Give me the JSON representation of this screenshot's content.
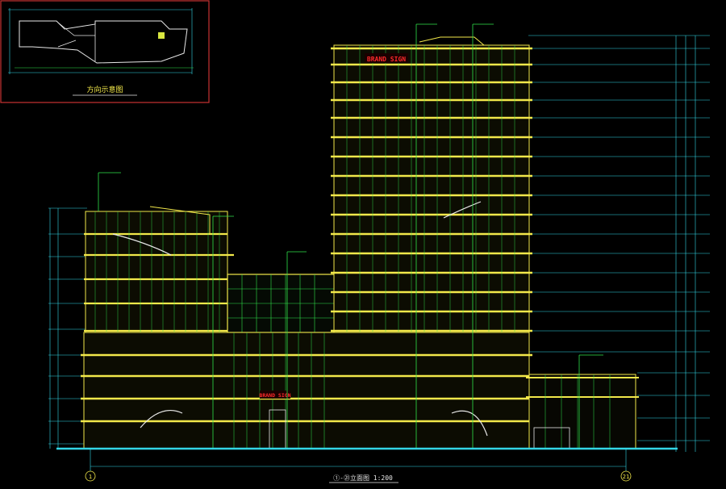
{
  "drawing": {
    "key_plan_title": "方向示意图",
    "elevation_title": "①-㉑立面图 1:200",
    "axis_start": "1",
    "axis_end": "21",
    "signage_top": "BRAND SIGN",
    "signage_podium": "BRAND SIGN"
  },
  "colors": {
    "background": "#000000",
    "facade_yellow": "#f2e84a",
    "glazing_green": "#2fe34a",
    "dimension_cyan": "#33d6e6",
    "frame_red": "#c83232",
    "signage_red": "#ff2a2a",
    "text_white": "#e8e8e8"
  }
}
